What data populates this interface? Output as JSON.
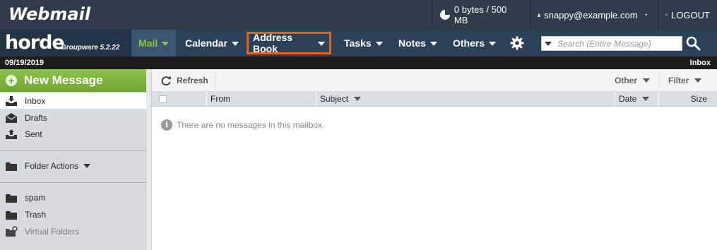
{
  "topbar": {
    "app_title": "Webmail",
    "quota": "0 bytes / 500 MB",
    "user_email": "snappy@example.com",
    "logout_label": "LOGOUT"
  },
  "branding": {
    "name": "horde",
    "subtitle": "Groupware 5.2.22"
  },
  "nav": {
    "items": [
      {
        "label": "Mail"
      },
      {
        "label": "Calendar"
      },
      {
        "label": "Address Book"
      },
      {
        "label": "Tasks"
      },
      {
        "label": "Notes"
      },
      {
        "label": "Others"
      }
    ],
    "highlight_color": "#e8641e",
    "active_color": "#8cc63f"
  },
  "search": {
    "placeholder": "Search (Entire Message)"
  },
  "status": {
    "date": "09/19/2019",
    "current_folder": "Inbox"
  },
  "sidebar": {
    "new_message_label": "New Message",
    "folders": [
      {
        "label": "Inbox",
        "icon": "inbox-icon"
      },
      {
        "label": "Drafts",
        "icon": "drafts-icon"
      },
      {
        "label": "Sent",
        "icon": "sent-icon"
      }
    ],
    "folder_actions_label": "Folder Actions",
    "extra_folders": [
      {
        "label": "spam",
        "icon": "folder-icon"
      },
      {
        "label": "Trash",
        "icon": "folder-icon"
      },
      {
        "label": "Virtual Folders",
        "icon": "folder-settings-icon"
      }
    ]
  },
  "toolbar": {
    "refresh_label": "Refresh",
    "other_label": "Other",
    "filter_label": "Filter"
  },
  "columns": {
    "from": "From",
    "subject": "Subject",
    "date": "Date",
    "size": "Size"
  },
  "messages": {
    "empty_text": "There are no messages in this mailbox."
  }
}
